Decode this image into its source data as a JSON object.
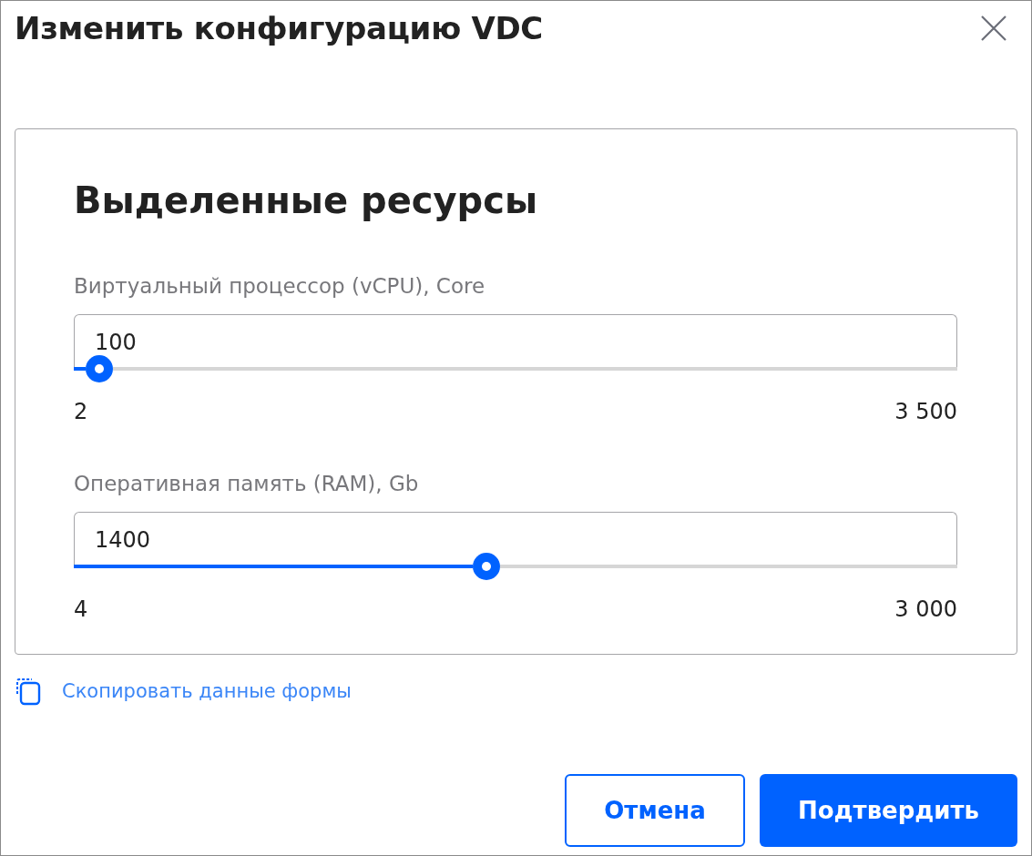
{
  "dialog": {
    "title": "Изменить конфигурацию VDC"
  },
  "section": {
    "title": "Выделенные ресурсы"
  },
  "sliders": [
    {
      "label": "Виртуальный процессор (vCPU), Core",
      "value": "100",
      "level": 0.029,
      "min": "2",
      "max": "3 500"
    },
    {
      "label": "Оперативная память (RAM), Gb",
      "value": "1400",
      "level": 0.467,
      "min": "4",
      "max": "3 000"
    }
  ],
  "copy_link": "Скопировать данные формы",
  "buttons": [
    {
      "label": "Отмена",
      "kind": "secondary"
    },
    {
      "label": "Подтвердить",
      "kind": "primary"
    }
  ]
}
